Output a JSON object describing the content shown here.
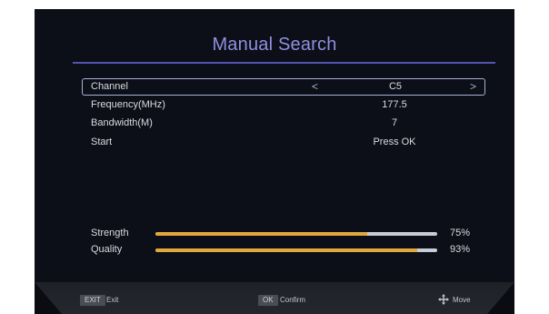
{
  "title": "Manual Search",
  "rows": [
    {
      "label": "Channel",
      "value": "C5",
      "selected": true
    },
    {
      "label": "Frequency(MHz)",
      "value": "177.5"
    },
    {
      "label": "Bandwidth(M)",
      "value": "7"
    },
    {
      "label": "Start",
      "value": "Press OK"
    }
  ],
  "arrows": {
    "left": "<",
    "right": ">"
  },
  "meters": [
    {
      "label": "Strength",
      "percent_text": "75%",
      "level": 0.75
    },
    {
      "label": "Quality",
      "percent_text": "93%",
      "level": 0.93
    }
  ],
  "colors": {
    "title": "#8f8fe0",
    "accent_line": "#5454b0",
    "meter_fill": "#e2a83b",
    "meter_track": "#c9ccd6",
    "background": "#0c0f17"
  },
  "footer": {
    "exit_key": "EXIT",
    "exit_desc": "Exit",
    "ok_key": "OK",
    "ok_desc": "Confirm",
    "move_icon": "move-arrows-icon",
    "move_desc": "Move"
  }
}
